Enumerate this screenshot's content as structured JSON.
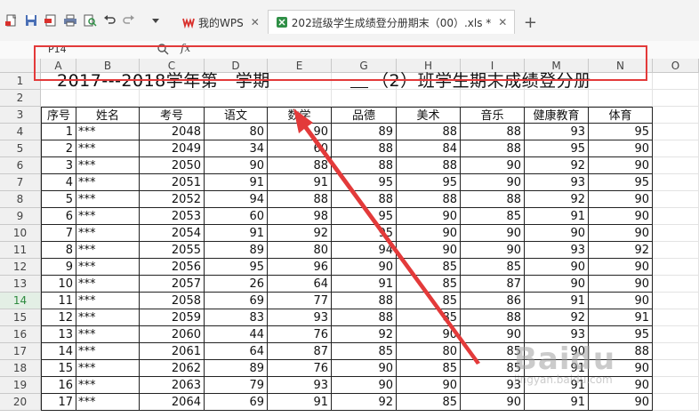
{
  "toolbar": {
    "icons": [
      "new-file-icon",
      "save-icon",
      "export-pdf-icon",
      "print-icon",
      "print-preview-icon",
      "undo-icon",
      "redo-icon",
      "dropdown-icon"
    ]
  },
  "tabs": [
    {
      "label": "我的WPS",
      "icon": "wps-logo-icon",
      "active": false
    },
    {
      "label": "202班级学生成绩登分册期末（00）.xls *",
      "icon": "spreadsheet-icon",
      "active": true
    }
  ],
  "formula_bar": {
    "name_box": "P14",
    "fx_label": "fx"
  },
  "columns": [
    "A",
    "B",
    "C",
    "D",
    "E",
    "G",
    "H",
    "I",
    "M",
    "N",
    "O"
  ],
  "rows": [
    1,
    2,
    3,
    4,
    5,
    6,
    7,
    8,
    9,
    10,
    11,
    12,
    13,
    14,
    15,
    16,
    17,
    18,
    19,
    20
  ],
  "selected_row": 14,
  "sheet": {
    "title_left": "2017---2018学年第一学期",
    "title_right": "（2）班学生期末成绩登分册",
    "headers": [
      "序号",
      "姓名",
      "考号",
      "语文",
      "数学",
      "品德",
      "美术",
      "音乐",
      "健康教育",
      "体育"
    ],
    "records": [
      [
        "1",
        "***",
        "2048",
        "80",
        "90",
        "89",
        "88",
        "88",
        "93",
        "95"
      ],
      [
        "2",
        "***",
        "2049",
        "34",
        "60",
        "88",
        "84",
        "88",
        "95",
        "90"
      ],
      [
        "3",
        "***",
        "2050",
        "90",
        "88",
        "88",
        "88",
        "90",
        "92",
        "90"
      ],
      [
        "4",
        "***",
        "2051",
        "91",
        "91",
        "95",
        "95",
        "90",
        "93",
        "95"
      ],
      [
        "5",
        "***",
        "2052",
        "94",
        "88",
        "88",
        "88",
        "88",
        "92",
        "90"
      ],
      [
        "6",
        "***",
        "2053",
        "60",
        "98",
        "95",
        "90",
        "85",
        "91",
        "90"
      ],
      [
        "7",
        "***",
        "2054",
        "91",
        "92",
        "95",
        "90",
        "90",
        "90",
        "90"
      ],
      [
        "8",
        "***",
        "2055",
        "89",
        "80",
        "94",
        "90",
        "90",
        "93",
        "92"
      ],
      [
        "9",
        "***",
        "2056",
        "95",
        "96",
        "90",
        "85",
        "85",
        "90",
        "90"
      ],
      [
        "10",
        "***",
        "2057",
        "26",
        "64",
        "91",
        "85",
        "87",
        "90",
        "90"
      ],
      [
        "11",
        "***",
        "2058",
        "69",
        "77",
        "88",
        "85",
        "86",
        "91",
        "90"
      ],
      [
        "12",
        "***",
        "2059",
        "83",
        "93",
        "88",
        "85",
        "88",
        "92",
        "91"
      ],
      [
        "13",
        "***",
        "2060",
        "44",
        "76",
        "92",
        "90",
        "90",
        "93",
        "95"
      ],
      [
        "14",
        "***",
        "2061",
        "64",
        "87",
        "85",
        "80",
        "85",
        "90",
        "88"
      ],
      [
        "15",
        "***",
        "2062",
        "89",
        "76",
        "90",
        "85",
        "85",
        "91",
        "90"
      ],
      [
        "16",
        "***",
        "2063",
        "79",
        "93",
        "90",
        "90",
        "93",
        "91",
        "90"
      ],
      [
        "17",
        "***",
        "2064",
        "69",
        "91",
        "92",
        "85",
        "90",
        "91",
        "90"
      ]
    ]
  },
  "watermark": {
    "text": "Baidu",
    "sub": "jingyan.baidu.com"
  },
  "colors": {
    "annotation_red": "#e33a3a",
    "selected_row": "#2d8a3e",
    "tab_icon": "#2f8f46",
    "wps_red": "#d9302c"
  }
}
